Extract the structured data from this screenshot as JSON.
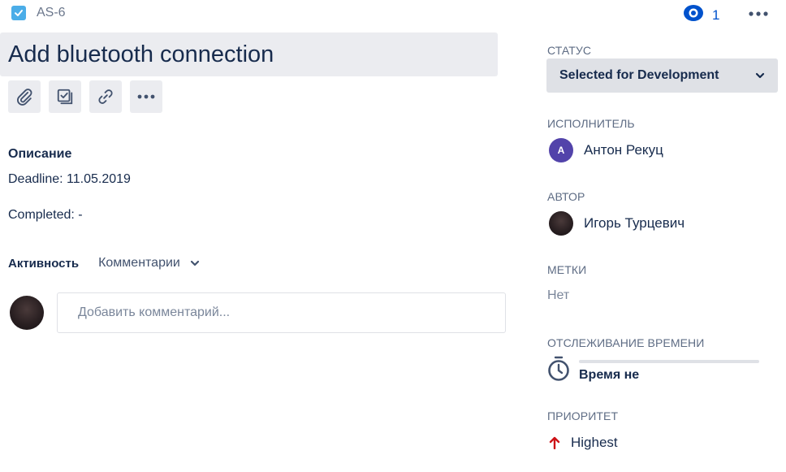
{
  "issue": {
    "key": "AS-6",
    "title": "Add bluetooth connection",
    "type_icon": "checkbox-task-icon"
  },
  "watch": {
    "count": "1",
    "icon": "eye-icon"
  },
  "toolbar": {
    "buttons": [
      "paperclip-icon",
      "subtask-icon",
      "link-icon",
      "more-icon"
    ]
  },
  "description": {
    "heading": "Описание",
    "lines": [
      "Deadline: 11.05.2019",
      "Completed: -"
    ]
  },
  "activity": {
    "label": "Активность",
    "filter": "Комментарии",
    "comment_placeholder": "Добавить комментарий..."
  },
  "sidebar": {
    "status": {
      "label": "СТАТУС",
      "value": "Selected for Development"
    },
    "assignee": {
      "label": "ИСПОЛНИТЕЛЬ",
      "initial": "A",
      "name": "Антон Рекуц"
    },
    "reporter": {
      "label": "АВТОР",
      "name": "Игорь Турцевич"
    },
    "labels": {
      "label": "МЕТКИ",
      "value": "Нет"
    },
    "time_tracking": {
      "label": "ОТСЛЕЖИВАНИЕ ВРЕМЕНИ",
      "value": "Время не",
      "progress": 0
    },
    "priority": {
      "label": "ПРИОРИТЕТ",
      "value": "Highest"
    }
  },
  "colors": {
    "accent": "#0052cc",
    "task_icon": "#4bade8",
    "priority_highest": "#cd1317",
    "assignee_avatar": "#5243aa"
  }
}
